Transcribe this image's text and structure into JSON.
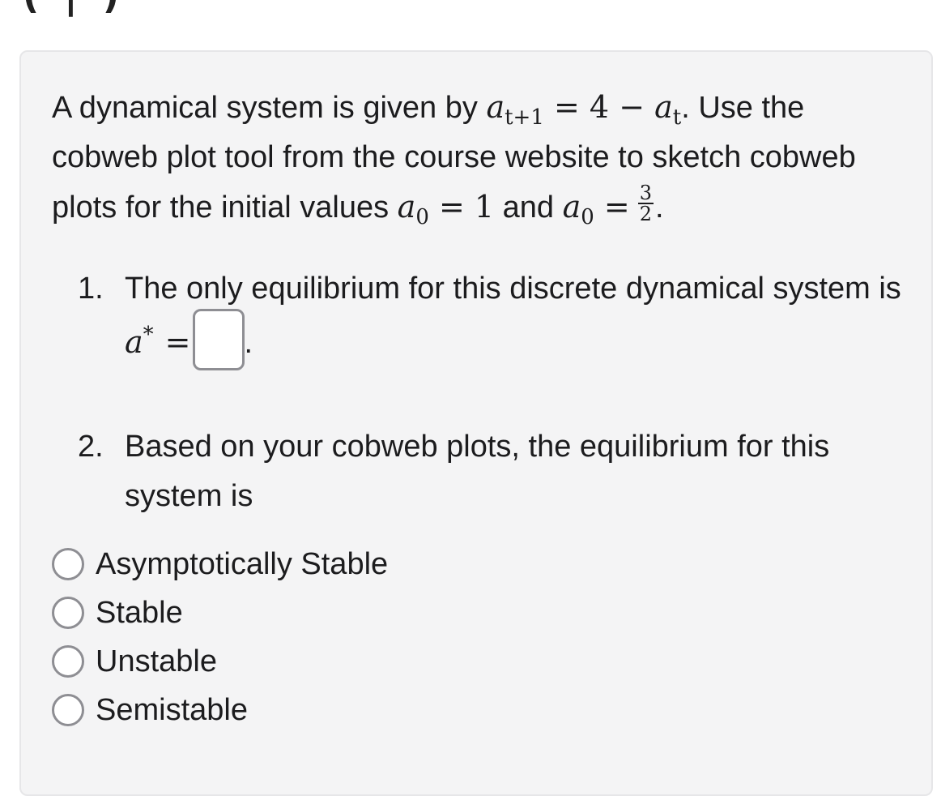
{
  "header_cutoff": "( |  )",
  "question": {
    "intro_prefix": "A dynamical system is given by ",
    "equation": {
      "lhs_var": "a",
      "lhs_sub": "t+1",
      "eq": "=",
      "rhs_const": "4",
      "minus": "−",
      "rhs_var": "a",
      "rhs_sub": "t"
    },
    "intro_mid": ". Use the cobweb plot tool from the course website to sketch cobweb plots for the initial values ",
    "init1": {
      "var": "a",
      "sub": "0",
      "eq": "=",
      "value": "1"
    },
    "and": " and ",
    "init2": {
      "var": "a",
      "sub": "0",
      "eq": "=",
      "num": "3",
      "den": "2"
    },
    "end": "."
  },
  "parts": [
    {
      "number": "1.",
      "text_before": "The only equilibrium for this discrete dynamical system is ",
      "var": "a",
      "sup": "*",
      "eq": "=",
      "answer_value": "",
      "text_after": "."
    },
    {
      "number": "2.",
      "text": "Based on your cobweb plots, the equilibrium for this system is"
    }
  ],
  "options": [
    {
      "label": "Asymptotically Stable",
      "selected": false
    },
    {
      "label": "Stable",
      "selected": false
    },
    {
      "label": "Unstable",
      "selected": false
    },
    {
      "label": "Semistable",
      "selected": false
    }
  ]
}
